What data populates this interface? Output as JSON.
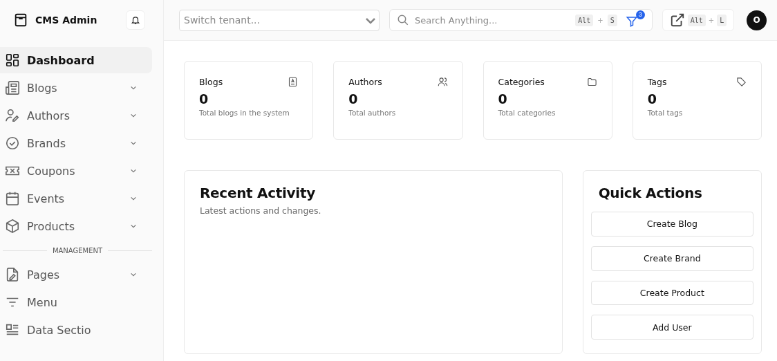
{
  "brand": {
    "title": "CMS Admin"
  },
  "tenant": {
    "placeholder": "Switch tenant..."
  },
  "search": {
    "placeholder": "Search Anything...",
    "keys": [
      "Alt",
      "+",
      "S"
    ],
    "filter_badge": "3"
  },
  "launch": {
    "keys": [
      "Alt",
      "+",
      "L"
    ]
  },
  "avatar": {
    "initial": "O"
  },
  "sidebar": {
    "items": [
      {
        "label": "Dashboard",
        "kind": "link",
        "selected": true
      },
      {
        "label": "Blogs",
        "kind": "group",
        "selected": false,
        "expanded": false
      },
      {
        "label": "Authors",
        "kind": "group",
        "selected": false,
        "expanded": false
      },
      {
        "label": "Brands",
        "kind": "group",
        "selected": false,
        "expanded": false
      },
      {
        "label": "Coupons",
        "kind": "group",
        "selected": false,
        "expanded": false
      },
      {
        "label": "Events",
        "kind": "group",
        "selected": false,
        "expanded": false
      },
      {
        "label": "Products",
        "kind": "group",
        "selected": false,
        "expanded": false
      },
      {
        "label": "MANAGEMENT",
        "kind": "section"
      },
      {
        "label": "Pages",
        "kind": "group",
        "selected": false,
        "expanded": false
      },
      {
        "label": "Menu",
        "kind": "link",
        "selected": false
      },
      {
        "label": "Data Sectio",
        "kind": "link",
        "selected": false
      }
    ]
  },
  "stats": [
    {
      "title": "Blogs",
      "value": "0",
      "caption": "Total blogs in the system"
    },
    {
      "title": "Authors",
      "value": "0",
      "caption": "Total authors"
    },
    {
      "title": "Categories",
      "value": "0",
      "caption": "Total categories"
    },
    {
      "title": "Tags",
      "value": "0",
      "caption": "Total tags"
    }
  ],
  "recent_activity": {
    "title": "Recent Activity",
    "subtitle": "Latest actions and changes."
  },
  "quick_actions": {
    "title": "Quick Actions",
    "buttons": [
      "Create Blog",
      "Create Brand",
      "Create Product",
      "Add User"
    ]
  }
}
